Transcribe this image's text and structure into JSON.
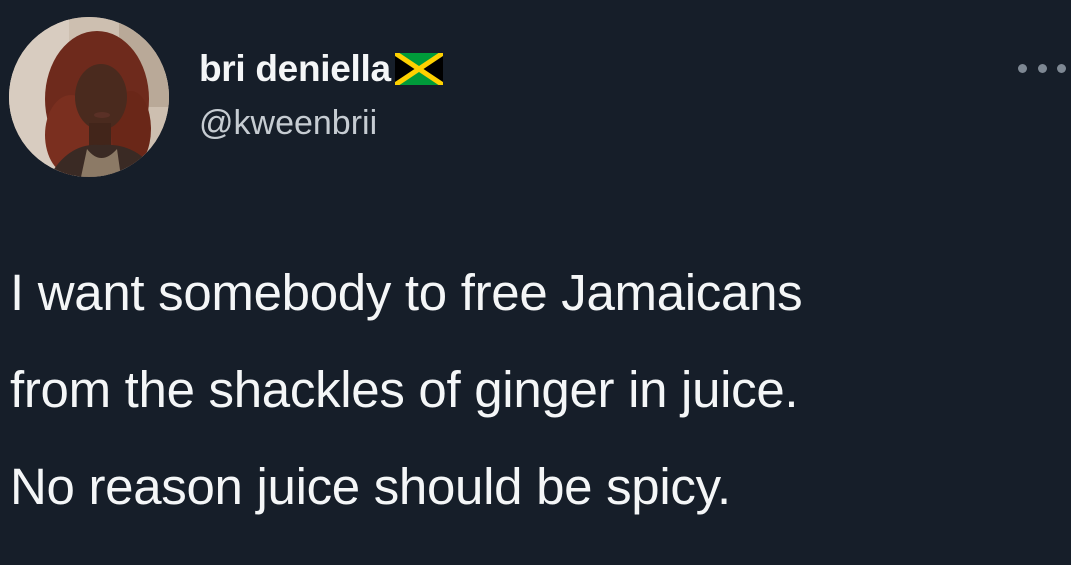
{
  "author": {
    "display_name": "bri deniella",
    "handle": "@kweenbrii",
    "flag_icon": "jamaica-flag-icon",
    "avatar_icon": "profile-photo"
  },
  "tweet": {
    "lines": [
      "I want somebody to free Jamaicans",
      "from the shackles of ginger in juice.",
      "No reason juice should be spicy."
    ]
  },
  "menu": {
    "icon": "more-options-icon"
  },
  "colors": {
    "background": "#161e29",
    "text": "#f4f6f7",
    "secondary_text": "#c6ccd2",
    "muted_icon": "#7e8893",
    "flag_green": "#009b3a",
    "flag_gold": "#fed100",
    "flag_black": "#000000"
  }
}
